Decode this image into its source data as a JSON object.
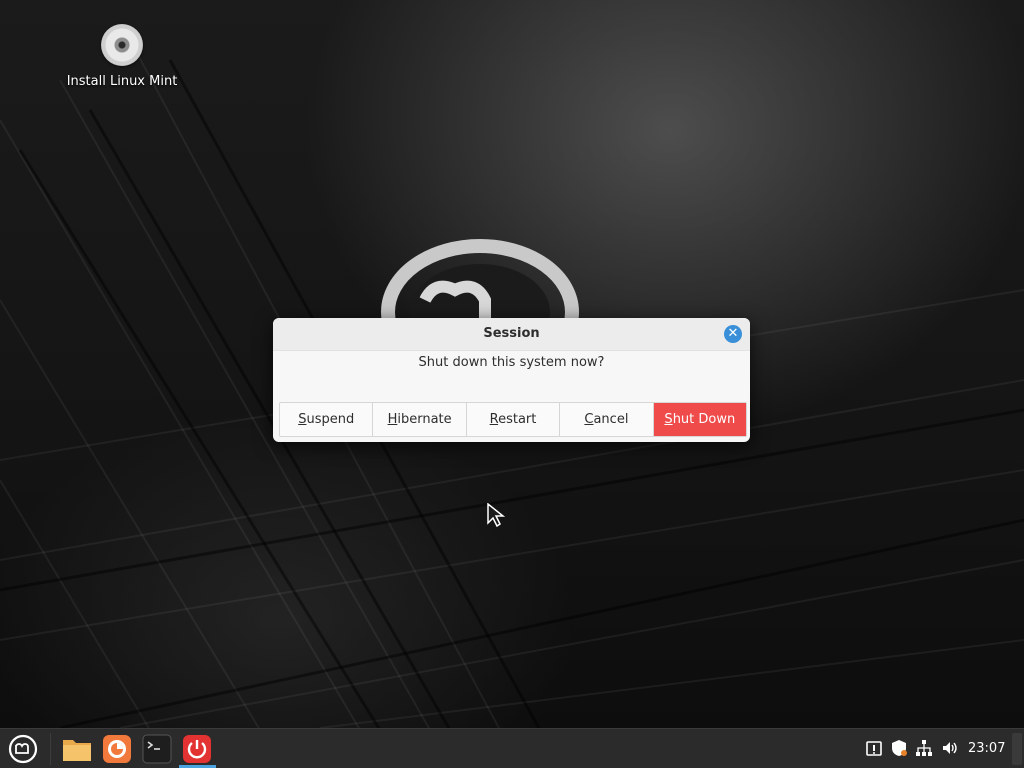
{
  "desktop": {
    "icons": [
      {
        "label": "Install Linux Mint",
        "icon": "disc-icon"
      }
    ]
  },
  "dialog": {
    "title": "Session",
    "message": "Shut down this system now?",
    "buttons": [
      {
        "label": "Suspend",
        "mnemonic": "S"
      },
      {
        "label": "Hibernate",
        "mnemonic": "H"
      },
      {
        "label": "Restart",
        "mnemonic": "R"
      },
      {
        "label": "Cancel",
        "mnemonic": "C"
      },
      {
        "label": "Shut Down",
        "mnemonic": "S"
      }
    ],
    "colors": {
      "accent": "#3a90d8",
      "danger": "#ef4b4b"
    }
  },
  "panel": {
    "launchers": [
      {
        "name": "files",
        "icon": "folder-icon"
      },
      {
        "name": "firefox",
        "icon": "firefox-icon"
      },
      {
        "name": "terminal",
        "icon": "terminal-icon"
      },
      {
        "name": "session",
        "icon": "power-icon",
        "active": true
      }
    ],
    "tray": [
      "update-manager-icon",
      "shield-icon",
      "network-icon",
      "volume-icon"
    ],
    "clock": "23:07"
  }
}
